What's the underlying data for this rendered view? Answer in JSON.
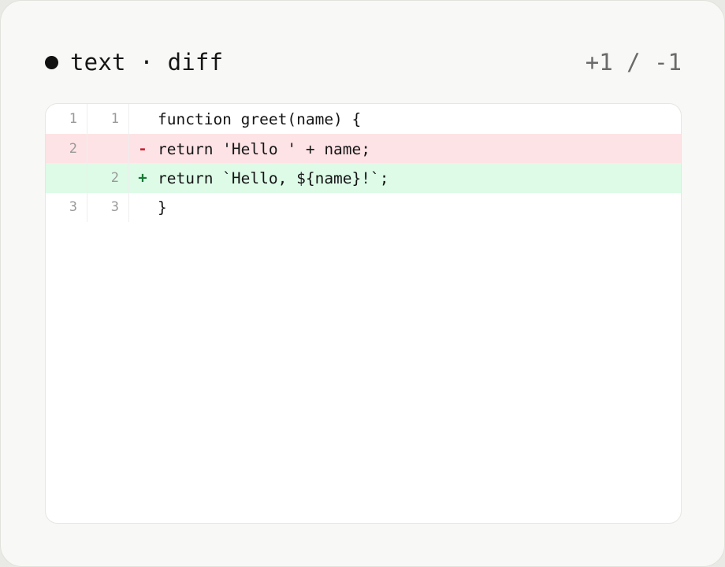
{
  "header": {
    "title": "text · diff",
    "stats": "+1 / -1"
  },
  "diff": {
    "lines": [
      {
        "old": "1",
        "new": "1",
        "sign": "",
        "code": "function greet(name) {"
      },
      {
        "old": "2",
        "new": "",
        "sign": "-",
        "code": "return 'Hello ' + name;"
      },
      {
        "old": "",
        "new": "2",
        "sign": "+",
        "code": "return `Hello, ${name}!`;"
      },
      {
        "old": "3",
        "new": "3",
        "sign": "",
        "code": "}"
      }
    ]
  },
  "colors": {
    "removed_bg": "#fde3e5",
    "added_bg": "#ddfbe7",
    "removed_sign": "#c72330",
    "added_sign": "#157a35"
  },
  "icons": {
    "status": "dot-icon"
  }
}
